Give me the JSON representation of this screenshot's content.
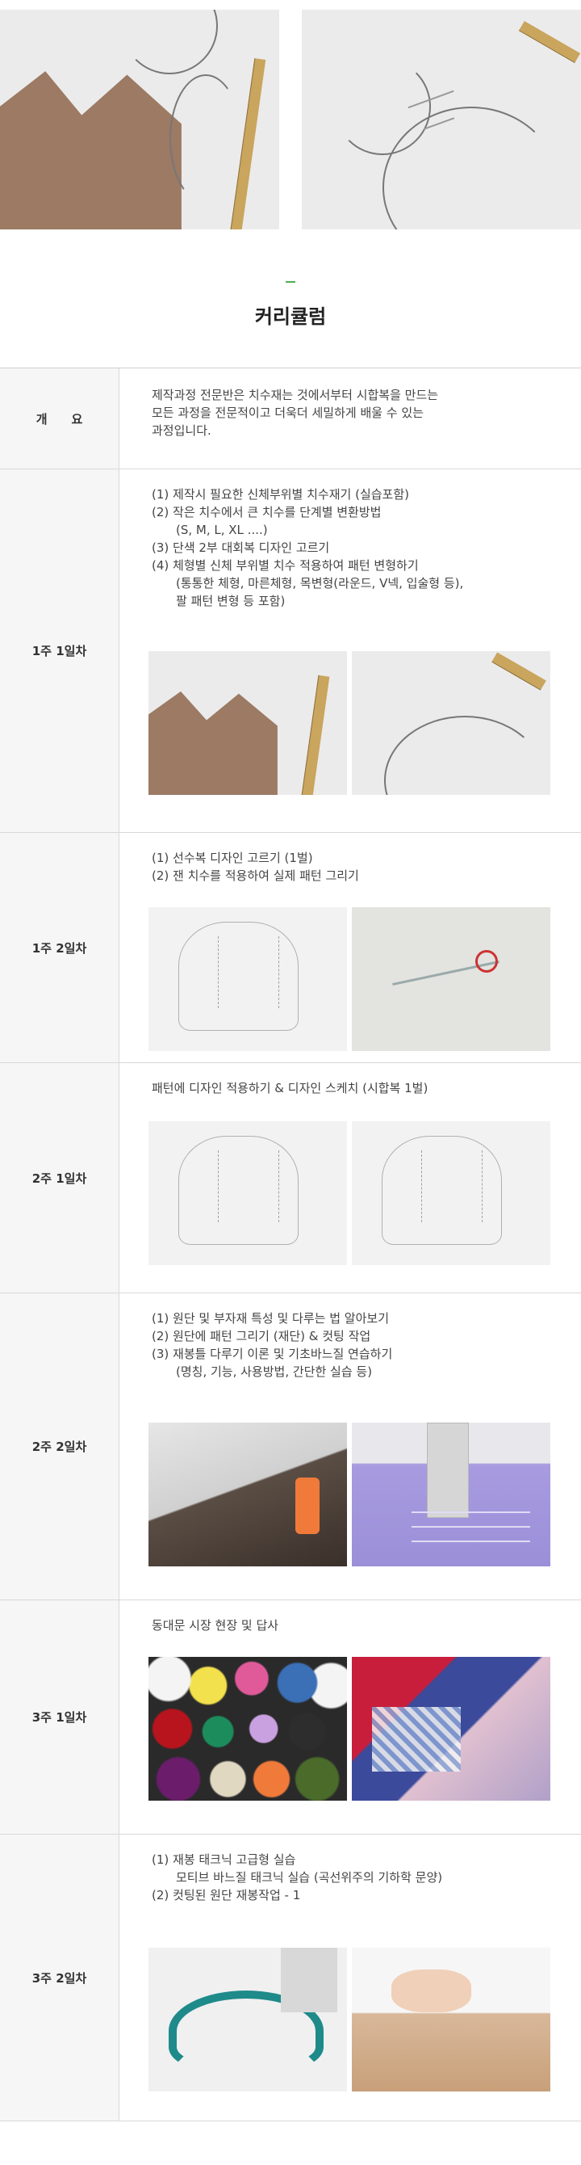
{
  "header_images": [
    {
      "name": "pattern-draft-photo-left"
    },
    {
      "name": "pattern-draft-photo-right"
    }
  ],
  "title": "커리큘럼",
  "accent_color": "#4caf50",
  "rows": [
    {
      "label": "개　　요",
      "lines": [
        "제작과정 전문반은 치수재는 것에서부터 시합복을 만드는",
        "모든 과정을 전문적이고 더욱더 세밀하게 배울 수 있는",
        "과정입니다."
      ]
    },
    {
      "label": "1주 1일차",
      "lines": [
        "(1) 제작시 필요한 신체부위별 치수재기 (실습포함)",
        "(2) 작은 치수에서 큰 치수를 단계별 변환방법",
        "(S, M, L, XL ....)",
        "(3) 단색 2부 대회복 디자인 고르기",
        "(4) 체형별 신체 부위별 치수 적용하여 패턴 변형하기",
        "(통통한 체형, 마른체형, 목변형(라운드, V넥, 입술형 등),",
        "팔 패턴 변형 등 포함)"
      ]
    },
    {
      "label": "1주 2일차",
      "lines": [
        "(1) 선수복 디자인 고르기 (1벌)",
        "(2) 잰 치수를 적용하여 실제 패턴 그리기"
      ]
    },
    {
      "label": "2주 1일차",
      "lines": [
        "패턴에 디자인 적용하기 & 디자인 스케치 (시합복 1벌)"
      ]
    },
    {
      "label": "2주 2일차",
      "lines": [
        "(1) 원단 및 부자재 특성 및 다루는 법 알아보기",
        "(2) 원단에 패턴 그리기 (재단) & 컷팅 작업",
        "(3) 재봉틀 다루기 이론 및 기초바느질 연습하기",
        "(명칭, 기능, 사용방법, 간단한 실습 등)"
      ]
    },
    {
      "label": "3주 1일차",
      "lines": [
        "동대문 시장 현장 및 답사"
      ]
    },
    {
      "label": "3주 2일차",
      "lines": [
        "(1) 재봉 태크닉 고급형 실습",
        "모티브 바느질 태크닉 실습 (곡선위주의 기하학 문양)",
        "(2) 컷팅된 원단 재봉작업 - 1"
      ]
    }
  ]
}
